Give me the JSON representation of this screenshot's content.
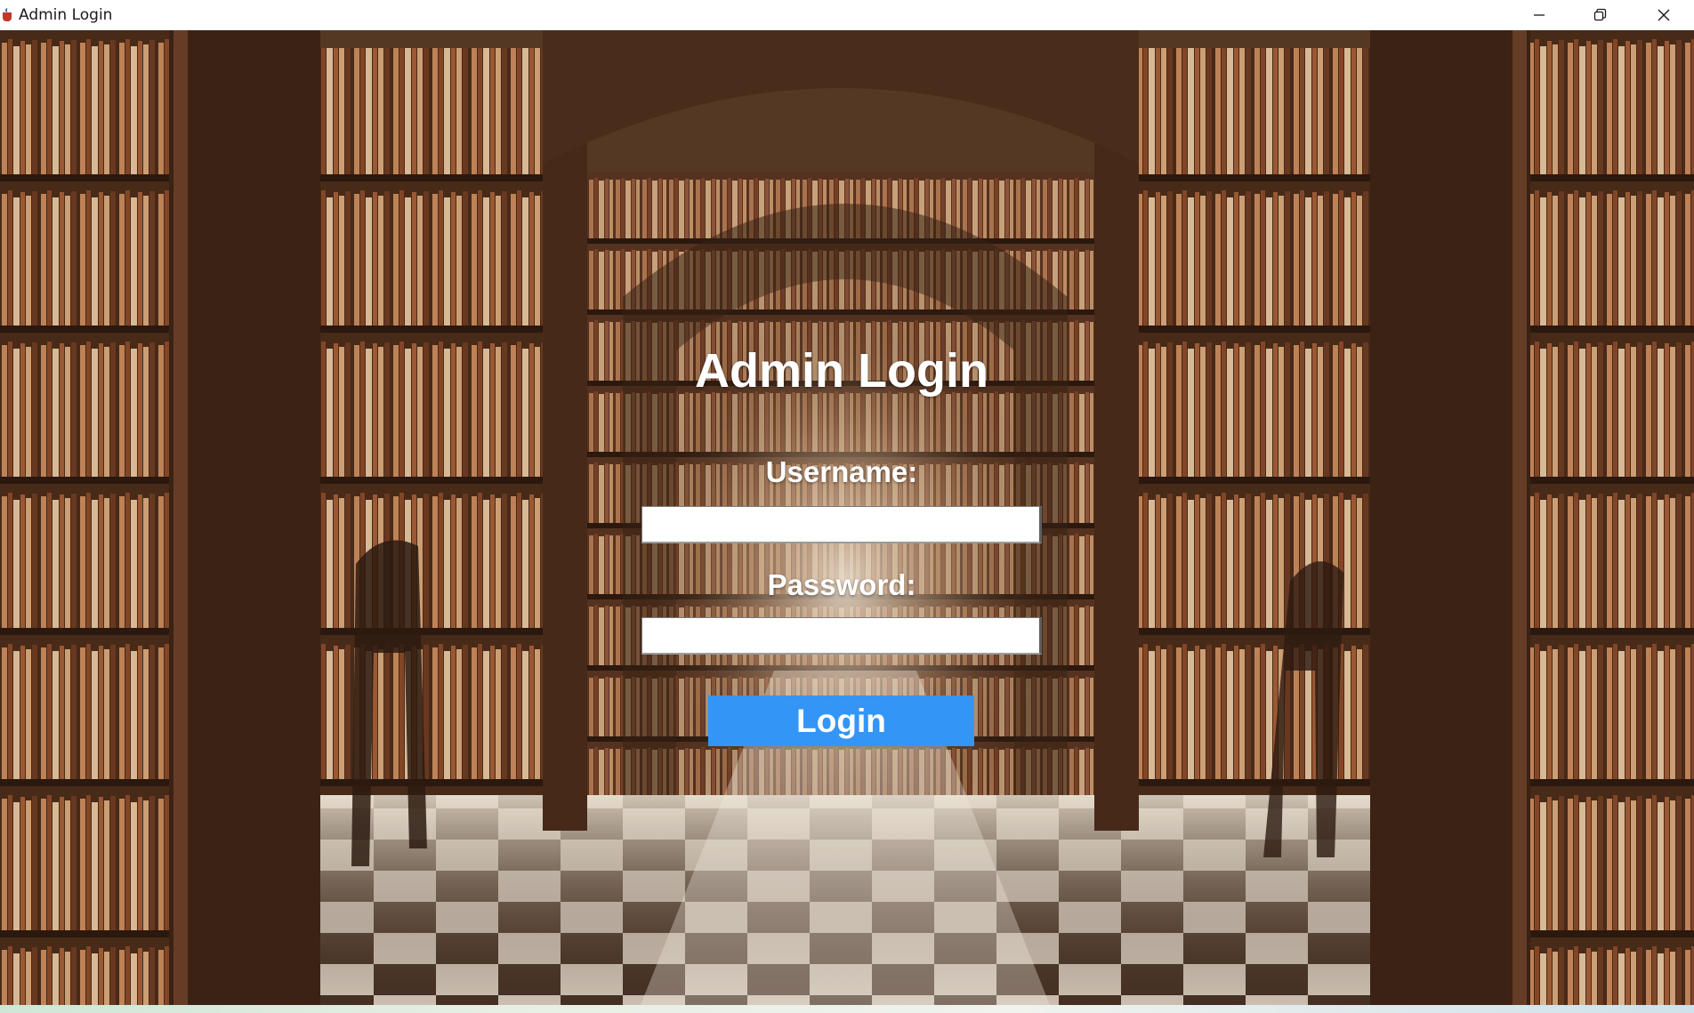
{
  "window": {
    "title": "Admin Login",
    "app_icon": "java-cup-icon",
    "controls": [
      "minimize-icon",
      "restore-icon",
      "close-icon"
    ]
  },
  "background": {
    "image": "library-hall-photo"
  },
  "login_form": {
    "heading": "Admin Login",
    "username_label": "Username:",
    "username_value": "",
    "password_label": "Password:",
    "password_value": "",
    "login_button_label": "Login"
  },
  "colors": {
    "login_button": "#3396f7",
    "label_text": "#ffffff"
  }
}
